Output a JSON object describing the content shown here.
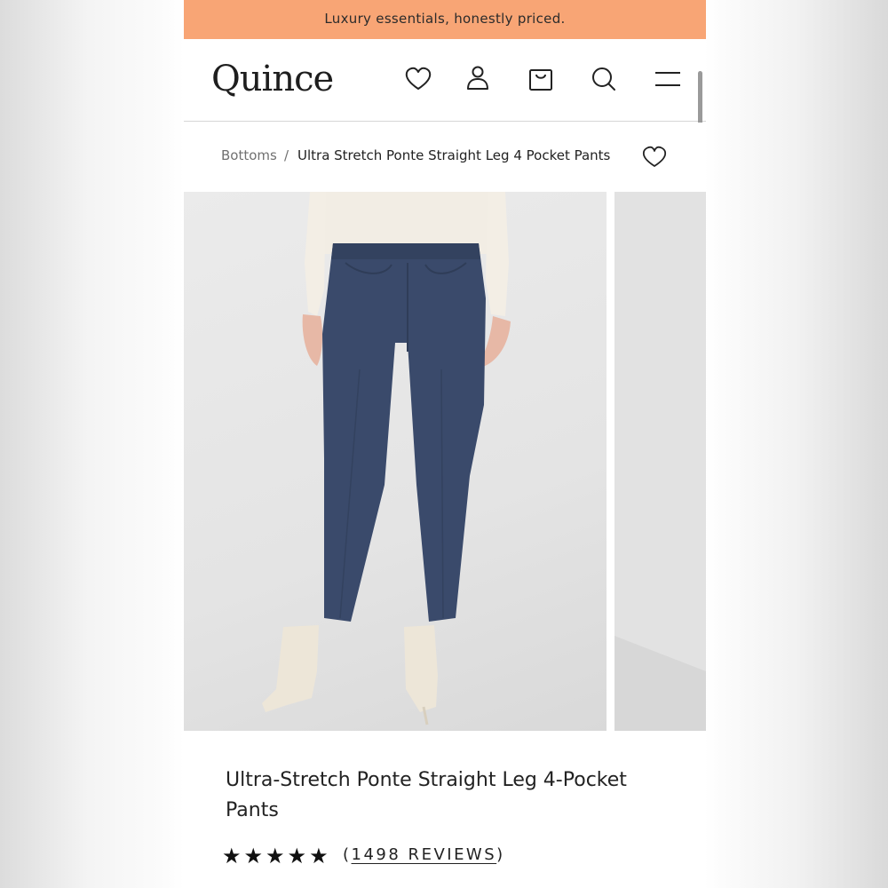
{
  "promo_banner": {
    "text": "Luxury essentials, honestly priced."
  },
  "header": {
    "logo": "Quince",
    "icons": [
      "heart-icon",
      "user-icon",
      "bag-icon",
      "search-icon",
      "menu-icon"
    ]
  },
  "breadcrumb": {
    "parent": "Bottoms",
    "separator": "/",
    "current": "Ultra Stretch Ponte Straight Leg 4 Pocket Pants"
  },
  "gallery": {
    "image_count_visible": 2
  },
  "product": {
    "title": "Ultra-Stretch Ponte Straight Leg 4-Pocket Pants",
    "rating_stars": 5,
    "stars_text": "★★★★★",
    "reviews_open": "(",
    "reviews_label": "1498 REVIEWS",
    "reviews_close": ")"
  },
  "colors": {
    "promo_bg": "#f8a575",
    "pants_navy": "#3a4a6b",
    "text": "#222222"
  }
}
